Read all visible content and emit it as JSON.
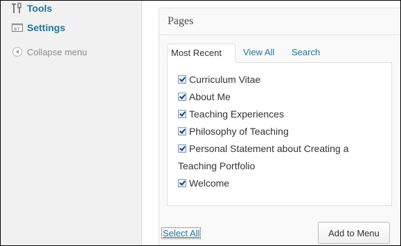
{
  "sidebar": {
    "items": [
      {
        "label": "Tools",
        "icon": "tools-icon"
      },
      {
        "label": "Settings",
        "icon": "settings-icon"
      }
    ],
    "collapse_label": "Collapse menu"
  },
  "pages_box": {
    "title": "Pages",
    "tabs": [
      {
        "label": "Most Recent",
        "active": true
      },
      {
        "label": "View All",
        "active": false
      },
      {
        "label": "Search",
        "active": false
      }
    ],
    "pages": [
      {
        "label": "Curriculum Vitae",
        "checked": true
      },
      {
        "label": "About Me",
        "checked": true
      },
      {
        "label": "Teaching Experiences",
        "checked": true
      },
      {
        "label": "Philosophy of Teaching",
        "checked": true
      },
      {
        "label": "Personal Statement about Creating a Teaching Portfolio",
        "checked": true
      },
      {
        "label": "Welcome",
        "checked": true
      }
    ],
    "select_all_label": "Select All",
    "add_button_label": "Add to Menu"
  },
  "colors": {
    "link": "#21759b",
    "sidebar_bg": "#f1f1f1",
    "panel_border": "#dfdfdf"
  }
}
